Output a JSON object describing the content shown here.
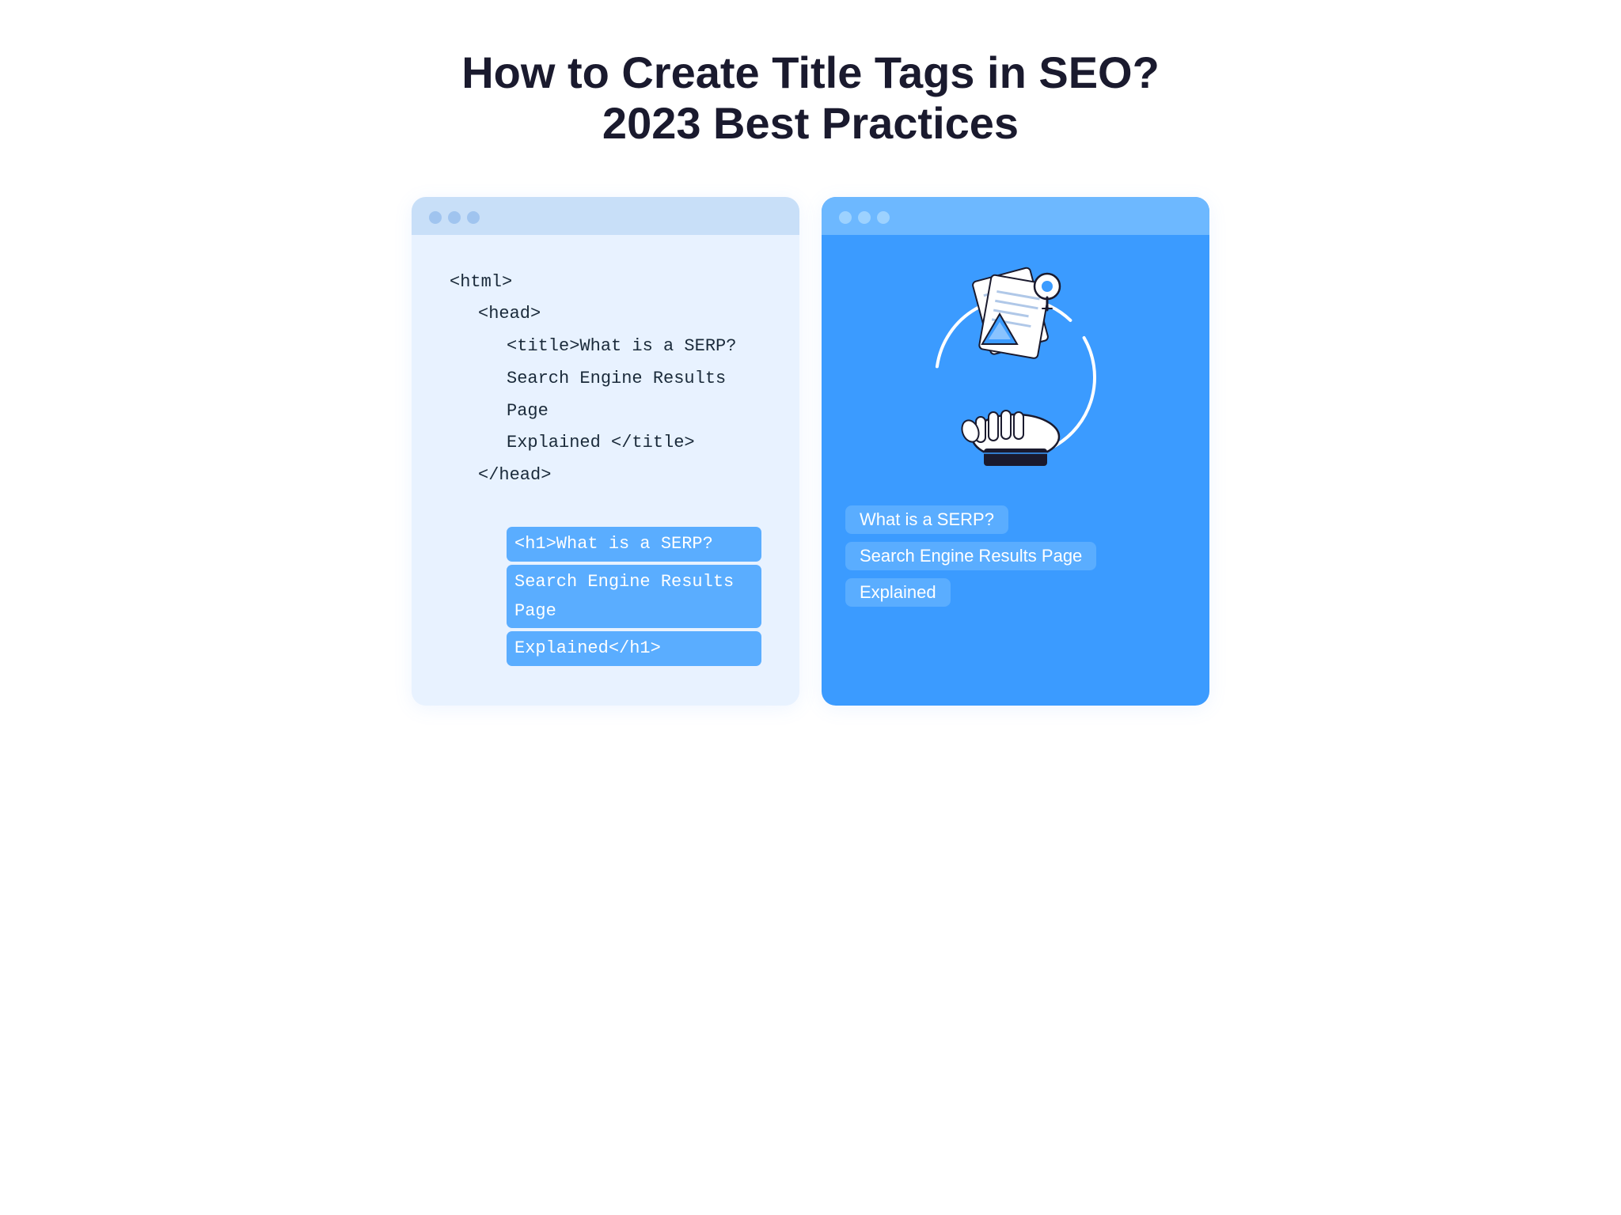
{
  "page": {
    "title_line1": "How to Create Title Tags in SEO?",
    "title_line2": "2023 Best Practices"
  },
  "left_card": {
    "topbar_dots": [
      "dot1",
      "dot2",
      "dot3"
    ],
    "code": {
      "html_open": "<html>",
      "head_open": "<head>",
      "title_open_and_text": "<title>What is a SERP?",
      "title_text2": "Search Engine Results Page",
      "title_text3": "Explained </title>",
      "head_close": "</head>",
      "h1_highlight1": "<h1>What is a SERP?",
      "h1_highlight2": "Search Engine Results Page",
      "h1_highlight3": "Explained</h1>"
    }
  },
  "right_card": {
    "topbar_dots": [
      "dot1",
      "dot2",
      "dot3"
    ],
    "highlight1": "What is a SERP?",
    "highlight2": "Search Engine Results Page",
    "highlight3": "Explained",
    "illustration_alt": "SERP illustration with hand holding documents and map pin"
  },
  "colors": {
    "left_card_bg": "#e8f2ff",
    "left_topbar_bg": "#c8dff8",
    "right_card_bg": "#3b9bff",
    "right_topbar_bg": "#6db8ff",
    "highlight_blue": "#5aadff",
    "title_color": "#1a1a2e"
  }
}
